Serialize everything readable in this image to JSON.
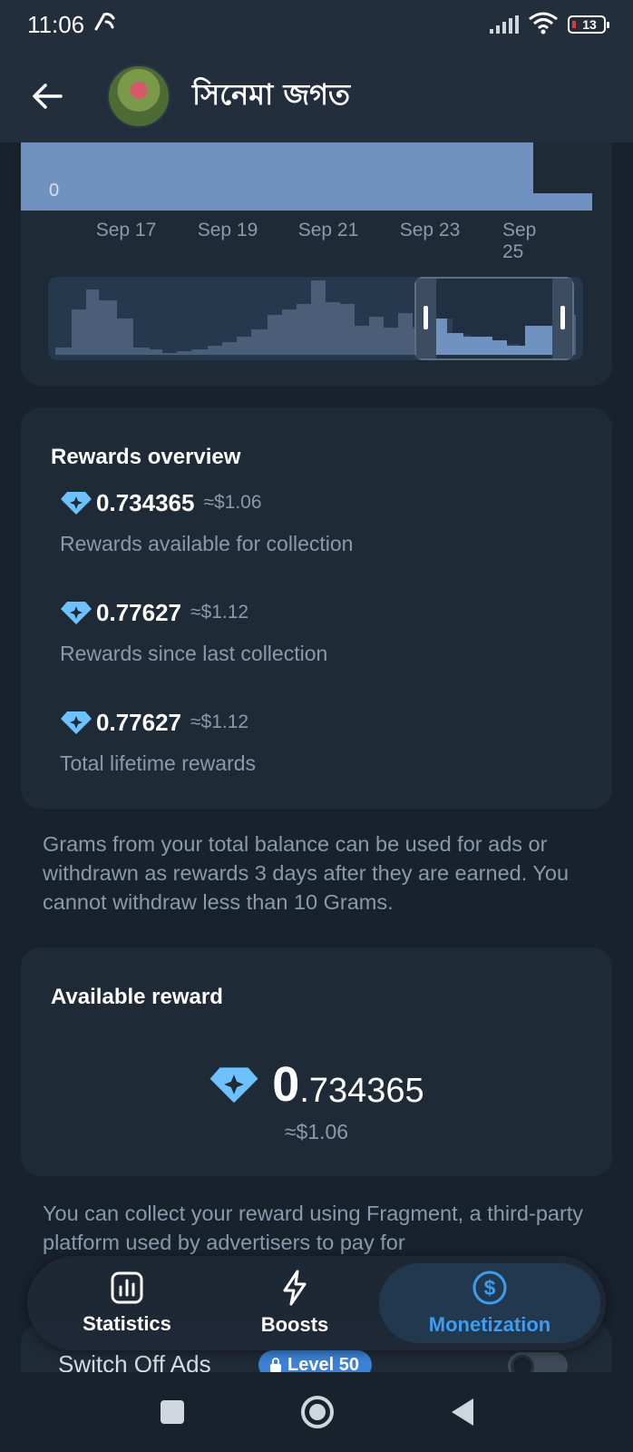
{
  "status_bar": {
    "time": "11:06",
    "battery_level": "13"
  },
  "header": {
    "title": "সিনেমা জগত"
  },
  "chart": {
    "zero_label": "0",
    "x_labels": [
      "Sep 17",
      "Sep 19",
      "Sep 21",
      "Sep 23",
      "Sep 25"
    ],
    "bar_color": "#6f92c0",
    "nav_bar_color": "#4a5e77"
  },
  "rewards_overview": {
    "title": "Rewards overview",
    "rows": [
      {
        "amount_int": "0",
        "amount_dec": ".734365",
        "usd": "≈$1.06",
        "description": "Rewards available for collection"
      },
      {
        "amount_int": "0",
        "amount_dec": ".77627",
        "usd": "≈$1.12",
        "description": "Rewards since last collection"
      },
      {
        "amount_int": "0",
        "amount_dec": ".77627",
        "usd": "≈$1.12",
        "description": "Total lifetime rewards"
      }
    ]
  },
  "balance_info": "Grams from your total balance can be used for ads or withdrawn as rewards 3 days after they are earned. You cannot withdraw less than 10 Grams.",
  "available_reward": {
    "title": "Available reward",
    "amount_int": "0",
    "amount_dec": ".734365",
    "usd": "≈$1.06"
  },
  "collect_info": "You can collect your reward using Fragment, a third-party platform used by advertisers to pay for",
  "ads_switch": {
    "label": "Switch Off Ads",
    "level_badge": "Level 50",
    "enabled": false
  },
  "tabs": [
    {
      "label": "Statistics",
      "icon": "chart-icon",
      "active": false
    },
    {
      "label": "Boosts",
      "icon": "lightning-icon",
      "active": false
    },
    {
      "label": "Monetization",
      "icon": "dollar-icon",
      "active": true
    }
  ],
  "colors": {
    "accent": "#3d9df0",
    "diamond": "#6ec1ff",
    "background": "#18222d",
    "card": "#1f2a37"
  }
}
